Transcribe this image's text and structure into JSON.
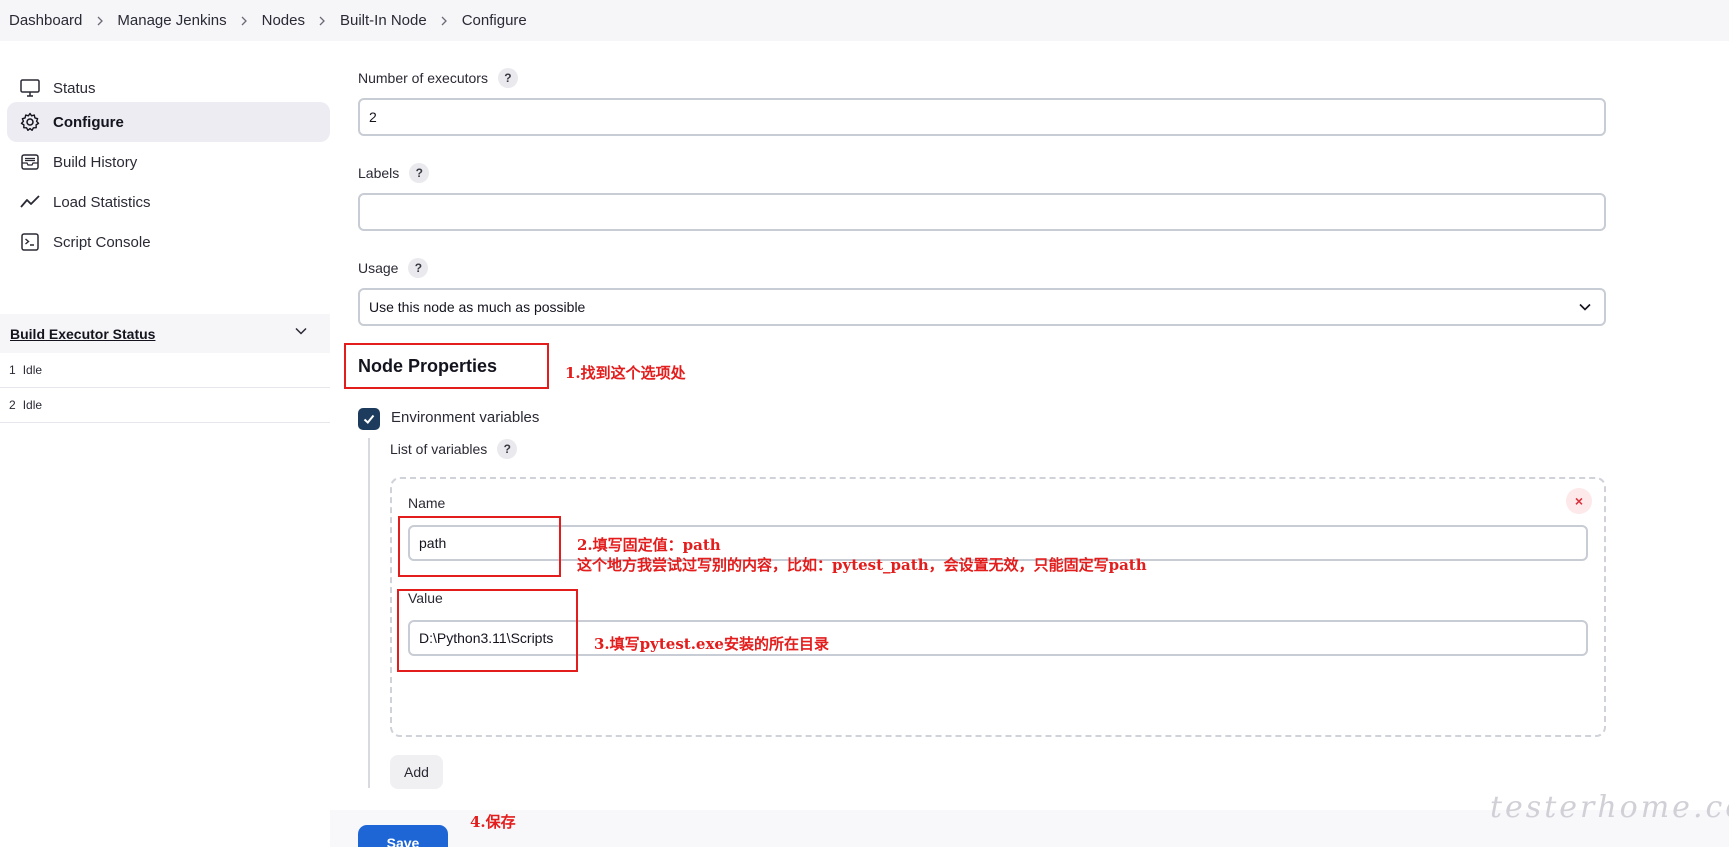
{
  "breadcrumb": [
    "Dashboard",
    "Manage Jenkins",
    "Nodes",
    "Built-In Node",
    "Configure"
  ],
  "sidebar": {
    "items": [
      {
        "label": "Status",
        "icon": "monitor-icon"
      },
      {
        "label": "Configure",
        "icon": "gear-icon"
      },
      {
        "label": "Build History",
        "icon": "inbox-icon"
      },
      {
        "label": "Load Statistics",
        "icon": "trend-icon"
      },
      {
        "label": "Script Console",
        "icon": "terminal-icon"
      }
    ],
    "active_index": 1,
    "executor_status": {
      "title": "Build Executor Status",
      "rows": [
        {
          "num": "1",
          "status": "Idle"
        },
        {
          "num": "2",
          "status": "Idle"
        }
      ]
    }
  },
  "form": {
    "executors": {
      "label": "Number of executors",
      "help": "?",
      "value": "2"
    },
    "labels": {
      "label": "Labels",
      "help": "?",
      "value": ""
    },
    "usage": {
      "label": "Usage",
      "help": "?",
      "value": "Use this node as much as possible"
    },
    "node_properties_title": "Node Properties",
    "env_vars": {
      "checkbox_label": "Environment variables",
      "checked": true,
      "list_label": "List of variables",
      "help": "?",
      "name_label": "Name",
      "name_value": "path",
      "value_label": "Value",
      "value_value": "D:\\Python3.11\\Scripts",
      "delete_symbol": "×",
      "add_label": "Add"
    },
    "save_label": "Save"
  },
  "annotations": {
    "a1": "1.找到这个选项处",
    "a2_line1": "2.填写固定值：path",
    "a2_line2": "这个地方我尝试过写别的内容，比如：pytest_path，会设置无效，只能固定写path",
    "a3": "3.填写pytest.exe安装的所在目录",
    "a4": "4.保存"
  },
  "watermark": "testerhome.com",
  "colors": {
    "accent": "#1e65d6",
    "checkbox": "#1d3b5c",
    "annotation": "#e31c1c",
    "active_bg": "#ececf2"
  }
}
